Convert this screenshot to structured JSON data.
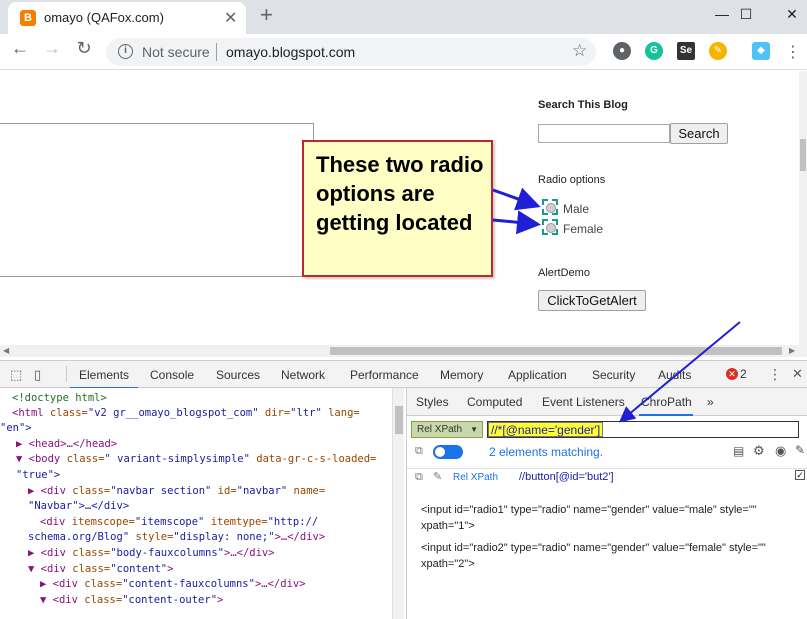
{
  "browser": {
    "tab_title": "omayo (QAFox.com)",
    "favicon_letter": "B",
    "new_tab": "+",
    "minimize": "—",
    "maximize": "☐",
    "close": "✕",
    "not_secure": "Not secure",
    "url": "omayo.blogspot.com"
  },
  "page": {
    "search_title": "Search This Blog",
    "search_button": "Search",
    "radio_title": "Radio options",
    "radio_male": "Male",
    "radio_female": "Female",
    "alert_title": "AlertDemo",
    "alert_button": "ClickToGetAlert"
  },
  "callout": {
    "text": "These two radio options are getting located"
  },
  "devtools": {
    "tabs": [
      "Elements",
      "Console",
      "Sources",
      "Network",
      "Performance",
      "Memory",
      "Application",
      "Security",
      "Audits"
    ],
    "error_count": "2",
    "more": "⋮",
    "close": "✕",
    "elements_lines": {
      "l1": "<!doctype html>",
      "l2a": "<html",
      "l2b": " class=",
      "l2c": "\"v2 gr__omayo_blogspot_com\"",
      "l2d": " dir=",
      "l2e": "\"ltr\"",
      "l2f": " lang=",
      "l3": "\"en\">",
      "l4": "▶ <head>…</head>",
      "l5a": "▼ <body",
      "l5b": " class=",
      "l5c": "\" variant-simplysimple\"",
      "l5d": " data-gr-c-s-loaded=",
      "l6": "\"true\">",
      "l7a": "▶ <div",
      "l7b": " class=",
      "l7c": "\"navbar section\"",
      "l7d": " id=",
      "l7e": "\"navbar\"",
      "l7f": " name=",
      "l8": "\"Navbar\">…</div>",
      "l9a": "<div",
      "l9b": " itemscope=",
      "l9c": "\"itemscope\"",
      "l9d": " itemtype=",
      "l9e": "\"http://",
      "l10a": "schema.org/Blog\"",
      "l10b": " style=",
      "l10c": "\"display: none;\"",
      "l10d": ">…</div>",
      "l11a": "▶ <div",
      "l11b": " class=",
      "l11c": "\"body-fauxcolumns\"",
      "l11d": ">…</div>",
      "l12a": "▼ <div",
      "l12b": " class=",
      "l12c": "\"content\"",
      "l12d": ">",
      "l13a": "▶ <div",
      "l13b": " class=",
      "l13c": "\"content-fauxcolumns\"",
      "l13d": ">…</div>",
      "l14a": "▼ <div",
      "l14b": " class=",
      "l14c": "\"content-outer\"",
      "l14d": ">"
    },
    "side_tabs": [
      "Styles",
      "Computed",
      "Event Listeners",
      "ChroPath",
      "»"
    ],
    "chropath": {
      "dropdown": "Rel XPath",
      "xpath_value": "//*[@name='gender']",
      "matching": "2 elements matching.",
      "rel_label": "Rel XPath",
      "rel_value": "//button[@id='but2']",
      "result1_a": "<input id=\"radio1\" type=\"radio\" name=\"gender\" value=\"male\" style=\"\"",
      "result1_b": "xpath=\"1\">",
      "result2_a": "<input id=\"radio2\" type=\"radio\" name=\"gender\" value=\"female\" style=\"\"",
      "result2_b": "xpath=\"2\">"
    }
  }
}
